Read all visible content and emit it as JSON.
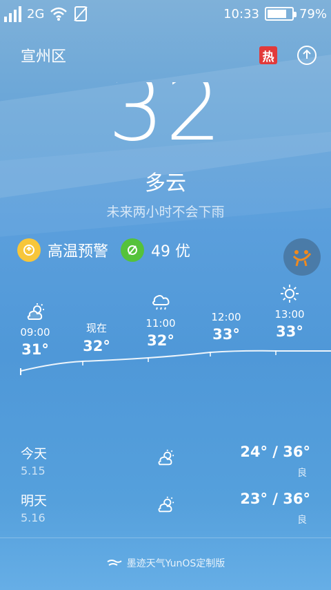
{
  "status": {
    "network": "2G",
    "time": "10:33",
    "battery_pct": "79%",
    "battery_level": 0.79
  },
  "header": {
    "city": "宣州区",
    "hot_label": "热"
  },
  "current": {
    "temperature": "32",
    "condition": "多云",
    "rain_note": "未来两小时不会下雨"
  },
  "alerts": {
    "heat_warning": "高温预警",
    "aqi": "49 优"
  },
  "hourly": [
    {
      "time": "09:00",
      "temp": "31°",
      "icon": "partly-cloudy-icon"
    },
    {
      "time": "现在",
      "temp": "32°",
      "icon": ""
    },
    {
      "time": "11:00",
      "temp": "32°",
      "icon": "rain-cloud-icon"
    },
    {
      "time": "12:00",
      "temp": "33°",
      "icon": ""
    },
    {
      "time": "13:00",
      "temp": "33°",
      "icon": "sun-icon"
    }
  ],
  "daily": [
    {
      "label": "今天",
      "date": "5.15",
      "range": "24° / 36°",
      "aq": "良",
      "icon": "partly-cloudy-icon"
    },
    {
      "label": "明天",
      "date": "5.16",
      "range": "23° / 36°",
      "aq": "良",
      "icon": "partly-cloudy-icon"
    }
  ],
  "footer": {
    "text": "墨迹天气YunOS定制版"
  }
}
